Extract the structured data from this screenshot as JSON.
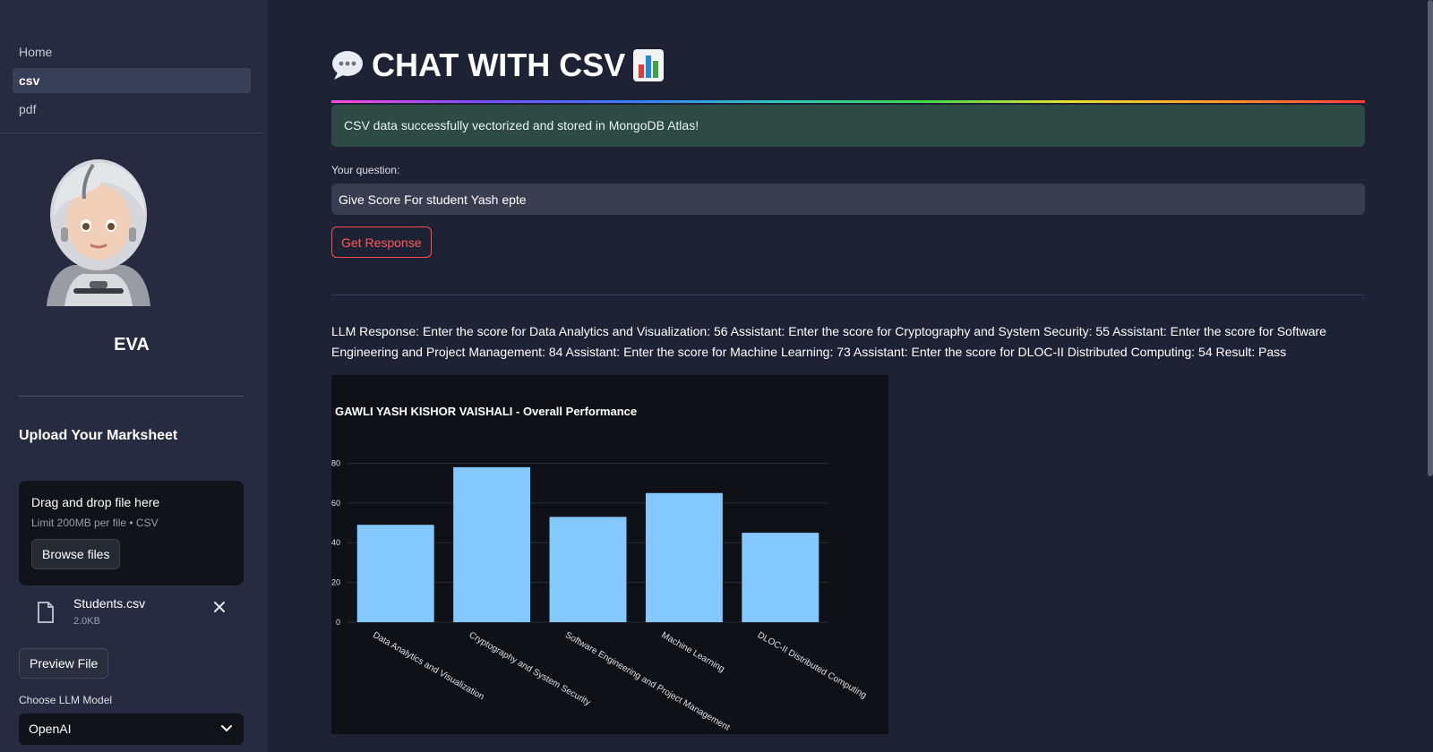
{
  "nav": {
    "items": [
      {
        "label": "Home",
        "active": false
      },
      {
        "label": "csv",
        "active": true
      },
      {
        "label": "pdf",
        "active": false
      }
    ]
  },
  "sidebar": {
    "bot_name": "EVA",
    "upload_title": "Upload Your Marksheet",
    "dropzone": {
      "title": "Drag and drop file here",
      "limit": "Limit 200MB per file • CSV",
      "browse_label": "Browse files"
    },
    "file": {
      "name": "Students.csv",
      "size": "2.0KB",
      "icon": "file-icon"
    },
    "preview_label": "Preview File",
    "llm_label": "Choose LLM Model",
    "llm_selected": "OpenAI"
  },
  "main": {
    "title": "CHAT WITH CSV",
    "title_icons": [
      "speech-bubble-icon",
      "bar-chart-icon"
    ],
    "success_message": "CSV data successfully vectorized and stored in MongoDB Atlas!",
    "question_label": "Your question:",
    "question_value": "Give Score For student Yash epte",
    "get_response_label": "Get Response",
    "response_text": "LLM Response: Enter the score for Data Analytics and Visualization: 56 Assistant: Enter the score for Cryptography and System Security: 55 Assistant: Enter the score for Software Engineering and Project Management: 84 Assistant: Enter the score for Machine Learning: 73 Assistant: Enter the score for DLOC-II Distributed Computing: 54 Result: Pass"
  },
  "colors": {
    "bar": "#83c9ff",
    "accent": "#ff4b4b",
    "success_bg": "#2e4a45"
  },
  "chart_data": {
    "type": "bar",
    "title": "GAWLI YASH KISHOR VAISHALI - Overall Performance",
    "categories": [
      "Data Analytics and Visualization",
      "Cryptography and System Security",
      "Software Engineering and Project Management",
      "Machine Learning",
      "DLOC-II Distributed Computing"
    ],
    "values": [
      49,
      78,
      53,
      65,
      45
    ],
    "yticks": [
      0,
      20,
      40,
      60,
      80
    ],
    "ylim": [
      0,
      82
    ],
    "grid": true
  }
}
